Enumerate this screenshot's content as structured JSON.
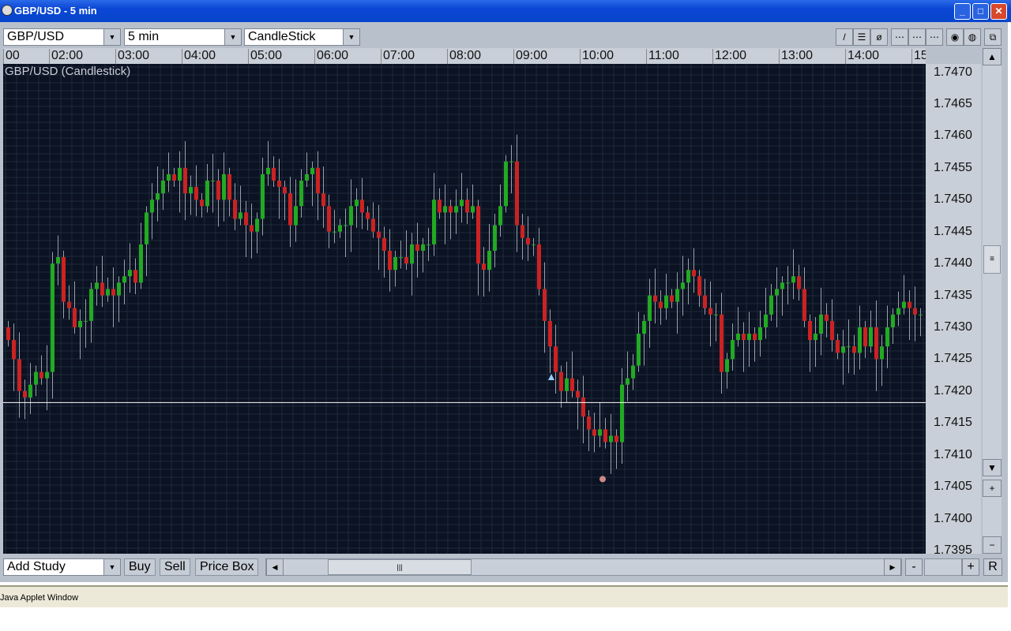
{
  "window": {
    "title": "GBP/USD - 5 min",
    "minimize": "_",
    "maximize": "□",
    "close": "✕"
  },
  "toolbar": {
    "symbol": "GBP/USD",
    "interval": "5 min",
    "chart_type": "CandleStick",
    "tools": [
      "line-tool-icon",
      "hline-tool-icon",
      "erase-tool-icon",
      "grid1-icon",
      "grid2-icon",
      "grid3-icon",
      "color1-icon",
      "color2-icon",
      "detach-icon"
    ]
  },
  "bottom": {
    "add_study": "Add Study",
    "buy": "Buy",
    "sell": "Sell",
    "price_box": "Price Box",
    "zoom_out": "-",
    "zoom_in": "+",
    "reset": "R",
    "scroll_grip": "|||"
  },
  "status": "Java Applet Window",
  "chart_data": {
    "type": "candlestick",
    "title": "GBP/USD (Candlestick)",
    "x_tick_labels": [
      "00",
      "02:00",
      "03:00",
      "04:00",
      "05:00",
      "06:00",
      "07:00",
      "08:00",
      "09:00",
      "10:00",
      "11:00",
      "12:00",
      "13:00",
      "14:00",
      "15"
    ],
    "y_tick_labels": [
      "1.7470",
      "1.7465",
      "1.7460",
      "1.7455",
      "1.7450",
      "1.7445",
      "1.7440",
      "1.7435",
      "1.7430",
      "1.7425",
      "1.7420",
      "1.7415",
      "1.7410",
      "1.7405",
      "1.7400",
      "1.7395"
    ],
    "ylim": [
      1.73945,
      1.74713
    ],
    "bar_interval_minutes": 5,
    "first_open": 1.743,
    "closes": [
      1.7428,
      1.7425,
      1.742,
      1.7419,
      1.7421,
      1.7423,
      1.7422,
      1.7423,
      1.744,
      1.7441,
      1.7434,
      1.7433,
      1.743,
      1.7431,
      1.7431,
      1.7436,
      1.7437,
      1.7435,
      1.7436,
      1.7435,
      1.7437,
      1.7438,
      1.7439,
      1.7437,
      1.7443,
      1.7448,
      1.745,
      1.7451,
      1.7453,
      1.7454,
      1.7453,
      1.7455,
      1.7451,
      1.7452,
      1.745,
      1.7449,
      1.7453,
      1.7453,
      1.745,
      1.7454,
      1.745,
      1.7447,
      1.7448,
      1.7446,
      1.7445,
      1.7447,
      1.7454,
      1.7455,
      1.7453,
      1.7452,
      1.7451,
      1.7446,
      1.7449,
      1.7453,
      1.7454,
      1.7455,
      1.7451,
      1.7449,
      1.7445,
      1.7445,
      1.7446,
      1.7446,
      1.7449,
      1.745,
      1.7448,
      1.7447,
      1.7445,
      1.7444,
      1.7442,
      1.7439,
      1.7441,
      1.7441,
      1.744,
      1.7443,
      1.7442,
      1.7443,
      1.7443,
      1.745,
      1.7448,
      1.7449,
      1.7448,
      1.7449,
      1.745,
      1.7448,
      1.7449,
      1.744,
      1.7439,
      1.7442,
      1.7446,
      1.7449,
      1.7456,
      1.7456,
      1.7446,
      1.7444,
      1.7443,
      1.7443,
      1.7436,
      1.7431,
      1.7427,
      1.7423,
      1.742,
      1.7422,
      1.742,
      1.7419,
      1.7416,
      1.7414,
      1.7413,
      1.7414,
      1.7412,
      1.7413,
      1.7412,
      1.7421,
      1.7422,
      1.7424,
      1.7429,
      1.7431,
      1.7435,
      1.7434,
      1.7433,
      1.7435,
      1.7434,
      1.7436,
      1.7437,
      1.7439,
      1.7438,
      1.7435,
      1.7433,
      1.7432,
      1.7432,
      1.7423,
      1.7425,
      1.7428,
      1.7429,
      1.7428,
      1.7429,
      1.7428,
      1.743,
      1.7432,
      1.7435,
      1.7436,
      1.7437,
      1.7437,
      1.7438,
      1.7436,
      1.7431,
      1.7428,
      1.7429,
      1.7432,
      1.7431,
      1.7428,
      1.7426,
      1.7427,
      1.7427,
      1.7426,
      1.743,
      1.7427,
      1.743,
      1.7425,
      1.7427,
      1.743,
      1.7432,
      1.7433,
      1.7434,
      1.7433,
      1.7432,
      1.7432
    ],
    "horizontal_line_price": 1.74182,
    "marker_price": 1.74062,
    "colors": {
      "up": "#22aa22",
      "down": "#cc2222",
      "wick": "#9aa0aa",
      "grid": "#1e2a3c",
      "background": "#0b1222",
      "hline": "#ffffff"
    }
  }
}
